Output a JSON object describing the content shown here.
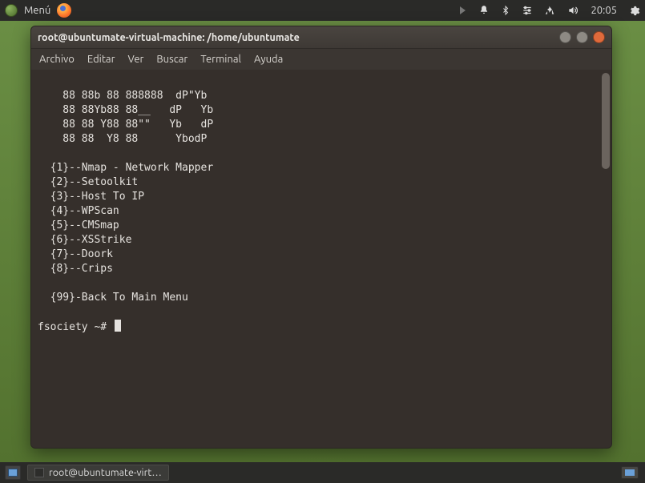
{
  "top_panel": {
    "menu_label": "Menú",
    "clock": "20:05"
  },
  "terminal": {
    "title": "root@ubuntumate-virtual-machine: /home/ubuntumate",
    "menu": {
      "file": "Archivo",
      "edit": "Editar",
      "view": "Ver",
      "search": "Buscar",
      "terminal": "Terminal",
      "help": "Ayuda"
    },
    "ascii": "    88 88b 88 888888  dP\"Yb\n    88 88Yb88 88__   dP   Yb\n    88 88 Y88 88\"\"   Yb   dP\n    88 88  Y8 88      YbodP",
    "options": [
      "  {1}--Nmap - Network Mapper",
      "  {2}--Setoolkit",
      "  {3}--Host To IP",
      "  {4}--WPScan",
      "  {5}--CMSmap",
      "  {6}--XSStrike",
      "  {7}--Doork",
      "  {8}--Crips",
      "",
      "  {99}-Back To Main Menu"
    ],
    "prompt": "fsociety ~# "
  },
  "bottom_panel": {
    "task_label": "root@ubuntumate-virt…"
  }
}
